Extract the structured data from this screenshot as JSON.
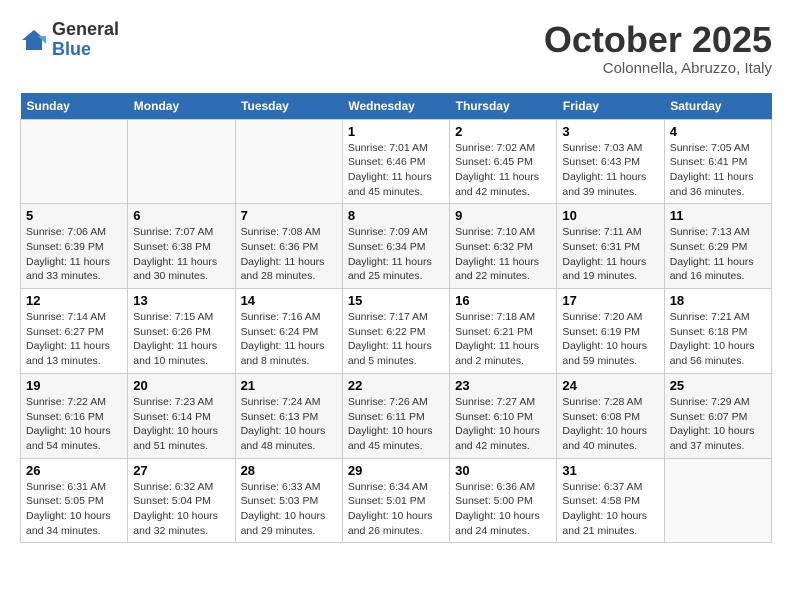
{
  "header": {
    "logo_general": "General",
    "logo_blue": "Blue",
    "month_title": "October 2025",
    "subtitle": "Colonnella, Abruzzo, Italy"
  },
  "weekdays": [
    "Sunday",
    "Monday",
    "Tuesday",
    "Wednesday",
    "Thursday",
    "Friday",
    "Saturday"
  ],
  "weeks": [
    [
      {
        "day": "",
        "detail": ""
      },
      {
        "day": "",
        "detail": ""
      },
      {
        "day": "",
        "detail": ""
      },
      {
        "day": "1",
        "detail": "Sunrise: 7:01 AM\nSunset: 6:46 PM\nDaylight: 11 hours and 45 minutes."
      },
      {
        "day": "2",
        "detail": "Sunrise: 7:02 AM\nSunset: 6:45 PM\nDaylight: 11 hours and 42 minutes."
      },
      {
        "day": "3",
        "detail": "Sunrise: 7:03 AM\nSunset: 6:43 PM\nDaylight: 11 hours and 39 minutes."
      },
      {
        "day": "4",
        "detail": "Sunrise: 7:05 AM\nSunset: 6:41 PM\nDaylight: 11 hours and 36 minutes."
      }
    ],
    [
      {
        "day": "5",
        "detail": "Sunrise: 7:06 AM\nSunset: 6:39 PM\nDaylight: 11 hours and 33 minutes."
      },
      {
        "day": "6",
        "detail": "Sunrise: 7:07 AM\nSunset: 6:38 PM\nDaylight: 11 hours and 30 minutes."
      },
      {
        "day": "7",
        "detail": "Sunrise: 7:08 AM\nSunset: 6:36 PM\nDaylight: 11 hours and 28 minutes."
      },
      {
        "day": "8",
        "detail": "Sunrise: 7:09 AM\nSunset: 6:34 PM\nDaylight: 11 hours and 25 minutes."
      },
      {
        "day": "9",
        "detail": "Sunrise: 7:10 AM\nSunset: 6:32 PM\nDaylight: 11 hours and 22 minutes."
      },
      {
        "day": "10",
        "detail": "Sunrise: 7:11 AM\nSunset: 6:31 PM\nDaylight: 11 hours and 19 minutes."
      },
      {
        "day": "11",
        "detail": "Sunrise: 7:13 AM\nSunset: 6:29 PM\nDaylight: 11 hours and 16 minutes."
      }
    ],
    [
      {
        "day": "12",
        "detail": "Sunrise: 7:14 AM\nSunset: 6:27 PM\nDaylight: 11 hours and 13 minutes."
      },
      {
        "day": "13",
        "detail": "Sunrise: 7:15 AM\nSunset: 6:26 PM\nDaylight: 11 hours and 10 minutes."
      },
      {
        "day": "14",
        "detail": "Sunrise: 7:16 AM\nSunset: 6:24 PM\nDaylight: 11 hours and 8 minutes."
      },
      {
        "day": "15",
        "detail": "Sunrise: 7:17 AM\nSunset: 6:22 PM\nDaylight: 11 hours and 5 minutes."
      },
      {
        "day": "16",
        "detail": "Sunrise: 7:18 AM\nSunset: 6:21 PM\nDaylight: 11 hours and 2 minutes."
      },
      {
        "day": "17",
        "detail": "Sunrise: 7:20 AM\nSunset: 6:19 PM\nDaylight: 10 hours and 59 minutes."
      },
      {
        "day": "18",
        "detail": "Sunrise: 7:21 AM\nSunset: 6:18 PM\nDaylight: 10 hours and 56 minutes."
      }
    ],
    [
      {
        "day": "19",
        "detail": "Sunrise: 7:22 AM\nSunset: 6:16 PM\nDaylight: 10 hours and 54 minutes."
      },
      {
        "day": "20",
        "detail": "Sunrise: 7:23 AM\nSunset: 6:14 PM\nDaylight: 10 hours and 51 minutes."
      },
      {
        "day": "21",
        "detail": "Sunrise: 7:24 AM\nSunset: 6:13 PM\nDaylight: 10 hours and 48 minutes."
      },
      {
        "day": "22",
        "detail": "Sunrise: 7:26 AM\nSunset: 6:11 PM\nDaylight: 10 hours and 45 minutes."
      },
      {
        "day": "23",
        "detail": "Sunrise: 7:27 AM\nSunset: 6:10 PM\nDaylight: 10 hours and 42 minutes."
      },
      {
        "day": "24",
        "detail": "Sunrise: 7:28 AM\nSunset: 6:08 PM\nDaylight: 10 hours and 40 minutes."
      },
      {
        "day": "25",
        "detail": "Sunrise: 7:29 AM\nSunset: 6:07 PM\nDaylight: 10 hours and 37 minutes."
      }
    ],
    [
      {
        "day": "26",
        "detail": "Sunrise: 6:31 AM\nSunset: 5:05 PM\nDaylight: 10 hours and 34 minutes."
      },
      {
        "day": "27",
        "detail": "Sunrise: 6:32 AM\nSunset: 5:04 PM\nDaylight: 10 hours and 32 minutes."
      },
      {
        "day": "28",
        "detail": "Sunrise: 6:33 AM\nSunset: 5:03 PM\nDaylight: 10 hours and 29 minutes."
      },
      {
        "day": "29",
        "detail": "Sunrise: 6:34 AM\nSunset: 5:01 PM\nDaylight: 10 hours and 26 minutes."
      },
      {
        "day": "30",
        "detail": "Sunrise: 6:36 AM\nSunset: 5:00 PM\nDaylight: 10 hours and 24 minutes."
      },
      {
        "day": "31",
        "detail": "Sunrise: 6:37 AM\nSunset: 4:58 PM\nDaylight: 10 hours and 21 minutes."
      },
      {
        "day": "",
        "detail": ""
      }
    ]
  ]
}
